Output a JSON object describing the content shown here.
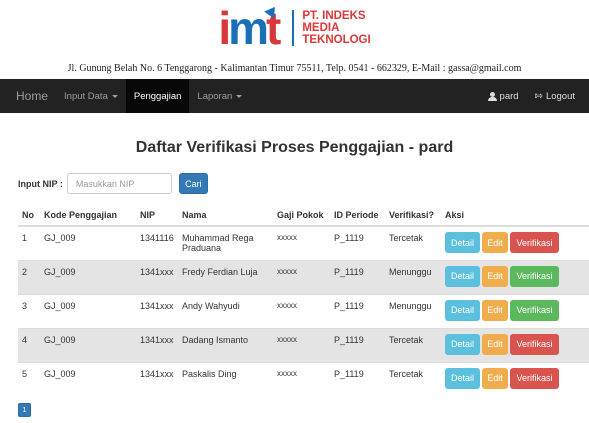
{
  "brand": {
    "line1": "PT. INDEKS",
    "line2": "MEDIA",
    "line3": "TEKNOLOGI"
  },
  "address": "Jl. Gunung Belah No. 6 Tenggarong - Kalimantan Timur 75511, Telp. 0541 - 662329, E-Mail : gassa@gmail.com",
  "nav": {
    "home": "Home",
    "input_data": "Input Data",
    "penggajian": "Penggajian",
    "laporan": "Laporan",
    "user": "pard",
    "logout": "Logout"
  },
  "page_title": "Daftar Verifikasi Proses Penggajian - pard",
  "search": {
    "label": "Input NIP :",
    "placeholder": "Masukkan NIP",
    "button": "Cari"
  },
  "table": {
    "headers": [
      "No",
      "Kode Penggajian",
      "NIP",
      "Nama",
      "Gaji Pokok",
      "ID Periode",
      "Verifikasi?",
      "Aksi"
    ],
    "rows": [
      {
        "no": "1",
        "kode": "GJ_009",
        "nip": "1341116",
        "nama": "Muhammad Rega Praduana",
        "gaji": "xxxxx",
        "periode": "P_1119",
        "status": "Tercetak",
        "action": "Verifikasi",
        "action_color": "#d9534f"
      },
      {
        "no": "2",
        "kode": "GJ_009",
        "nip": "1341xxx",
        "nama": "Fredy Ferdian Luja",
        "gaji": "xxxxx",
        "periode": "P_1119",
        "status": "Menunggu",
        "action": "Verifikasi",
        "action_color": "#5cb85c"
      },
      {
        "no": "3",
        "kode": "GJ_009",
        "nip": "1341xxx",
        "nama": "Andy Wahyudi",
        "gaji": "xxxxx",
        "periode": "P_1119",
        "status": "Menunggu",
        "action": "Verifikasi",
        "action_color": "#5cb85c"
      },
      {
        "no": "4",
        "kode": "GJ_009",
        "nip": "1341xxx",
        "nama": "Dadang Ismanto",
        "gaji": "xxxxx",
        "periode": "P_1119",
        "status": "Tercetak",
        "action": "Verifikasi",
        "action_color": "#d9534f"
      },
      {
        "no": "5",
        "kode": "GJ_009",
        "nip": "1341xxx",
        "nama": "Paskalis Ding",
        "gaji": "xxxxx",
        "periode": "P_1119",
        "status": "Tercetak",
        "action": "Verifikasi",
        "action_color": "#d9534f"
      }
    ],
    "detail_label": "Detail",
    "edit_label": "Edit"
  },
  "pagination": {
    "current_page": "1"
  },
  "colors": {
    "navbar": "#222222",
    "primary": "#337ab7",
    "info": "#5bc0de",
    "warning": "#f0ad4e",
    "danger": "#d9534f",
    "success": "#5cb85c"
  }
}
